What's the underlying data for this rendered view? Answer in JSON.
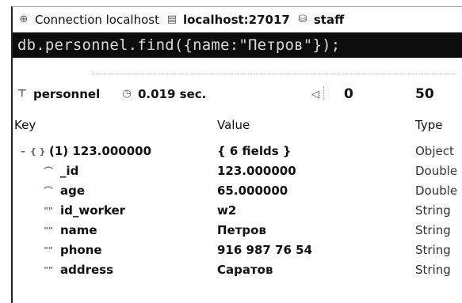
{
  "connection_bar": {
    "connection": "Connection localhost",
    "server": "localhost:27017",
    "database": "staff"
  },
  "query": "db.personnel.find({name:\"Петров\"});",
  "result_bar": {
    "collection": "personnel",
    "time": "0.019 sec.",
    "skip": "0",
    "limit": "50"
  },
  "table": {
    "headers": {
      "key": "Key",
      "value": "Value",
      "type": "Type"
    },
    "root": {
      "key": "(1) 123.000000",
      "value": "{ 6 fields }",
      "type": "Object"
    },
    "fields": [
      {
        "key": "_id",
        "value": "123.000000",
        "type": "Double"
      },
      {
        "key": "age",
        "value": "65.000000",
        "type": "Double"
      },
      {
        "key": "id_worker",
        "value": "w2",
        "type": "String"
      },
      {
        "key": "name",
        "value": "Петров",
        "type": "String"
      },
      {
        "key": "phone",
        "value": "916 987 76 54",
        "type": "String"
      },
      {
        "key": "address",
        "value": "Саратов",
        "type": "String"
      }
    ]
  }
}
